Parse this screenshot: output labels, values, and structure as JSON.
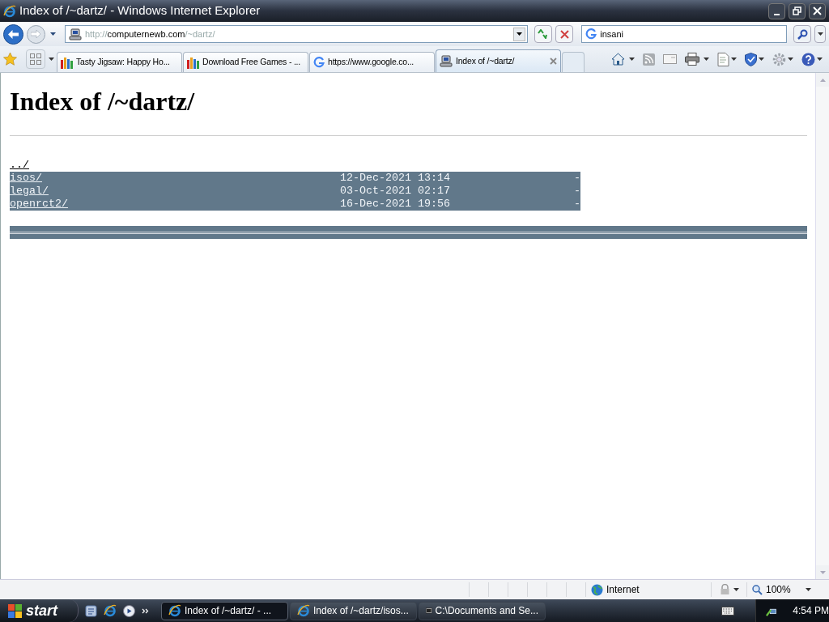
{
  "window": {
    "title": "Index of /~dartz/ - Windows Internet Explorer"
  },
  "address": {
    "scheme": "http://",
    "host": "computernewb.com",
    "path": "/~dartz/"
  },
  "search": {
    "value": "insani"
  },
  "tabs": [
    {
      "label": "Tasty Jigsaw: Happy Ho...",
      "kind": "games",
      "selected": false
    },
    {
      "label": "Download Free Games - ...",
      "kind": "games",
      "selected": false
    },
    {
      "label": "https://www.google.co...",
      "kind": "google",
      "selected": false
    },
    {
      "label": "Index of /~dartz/",
      "kind": "computer",
      "selected": true
    }
  ],
  "page": {
    "heading": "Index of /~dartz/",
    "entries": [
      {
        "name": "../",
        "selected": false
      },
      {
        "name": "isos/",
        "date": "12-Dec-2021 13:14",
        "size": "-",
        "selected": true
      },
      {
        "name": "legal/",
        "date": "03-Oct-2021 02:17",
        "size": "-",
        "selected": true
      },
      {
        "name": "openrct2/",
        "date": "16-Dec-2021 19:56",
        "size": "-",
        "selected": true
      }
    ],
    "bottom_rule_selected": true
  },
  "status_bar": {
    "zone": "Internet",
    "zoom": "100%"
  },
  "taskbar": {
    "start": "start",
    "tasks": [
      {
        "label": "Index of /~dartz/ - ...",
        "kind": "browser",
        "selected": true
      },
      {
        "label": "Index of /~dartz/isos...",
        "kind": "browser",
        "selected": false
      },
      {
        "label": "C:\\Documents and Se...",
        "kind": "archive",
        "selected": false
      }
    ],
    "clock": "4:54 PM"
  }
}
